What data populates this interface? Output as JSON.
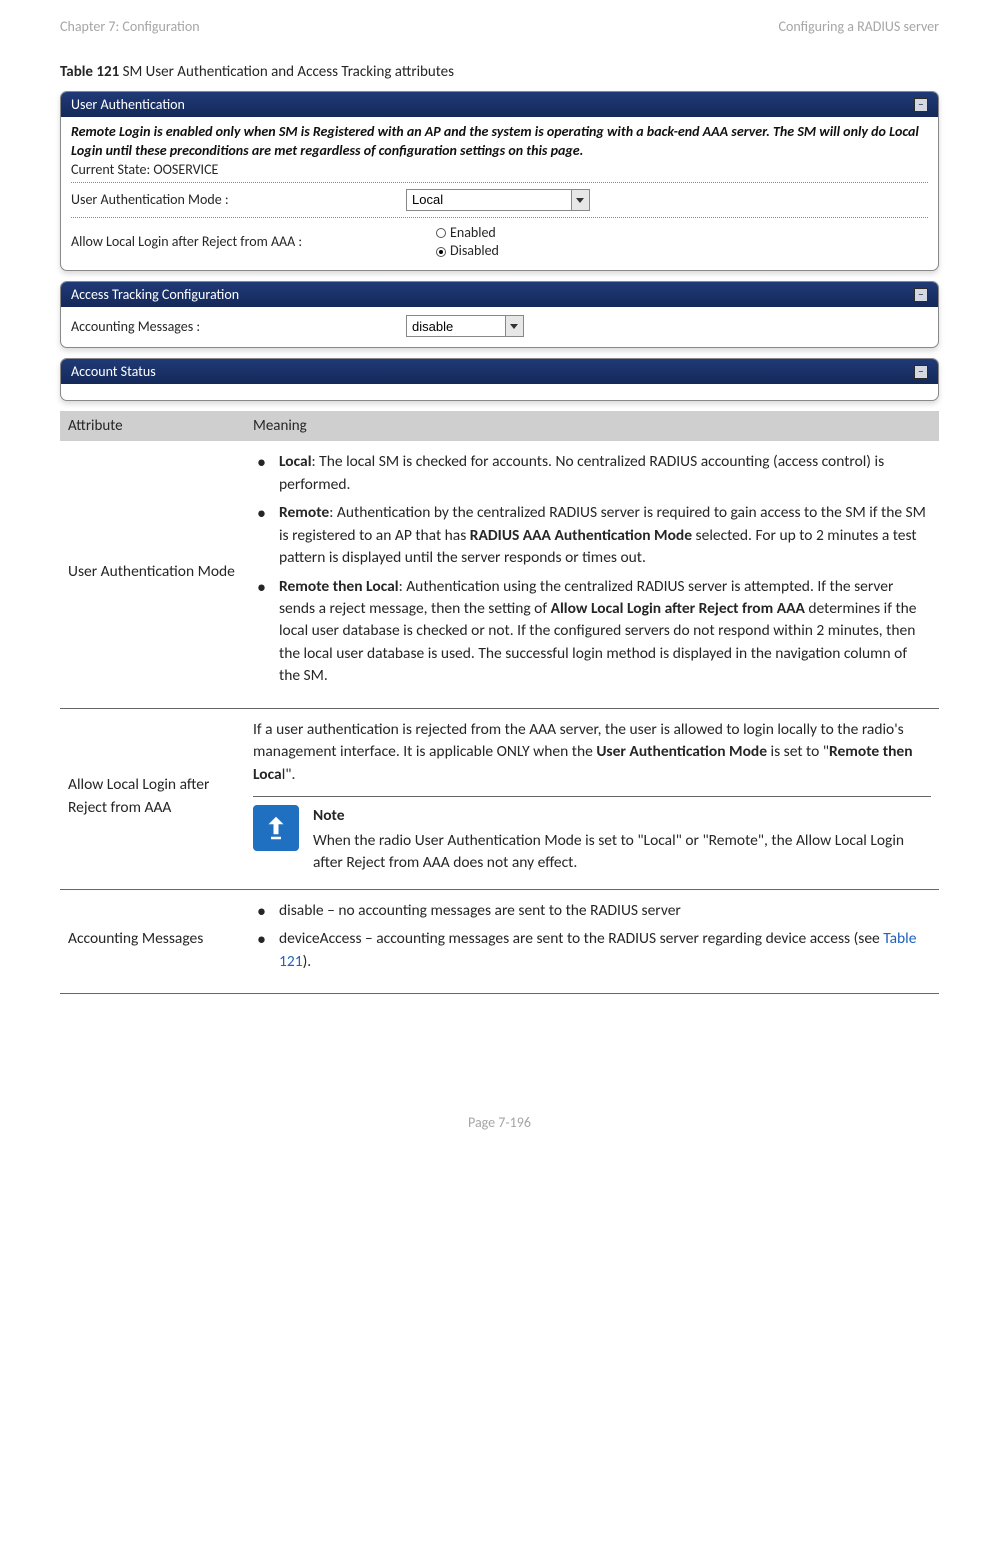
{
  "header": {
    "left": "Chapter 7:  Configuration",
    "right": "Configuring a RADIUS server"
  },
  "caption": {
    "bold": "Table 121",
    "rest": " SM User Authentication and Access Tracking attributes"
  },
  "panel1": {
    "title": "User Authentication",
    "intro": "Remote Login is enabled only when SM is Registered with an AP and the system is operating with a back-end AAA server. The SM will only do Local Login until these preconditions are met regardless of configuration settings on this page.",
    "stateLabel": "Current State: OOSERVICE",
    "modeLabel": "User Authentication Mode :",
    "modeValue": "Local",
    "allowLabel": "Allow Local Login after Reject from AAA :",
    "enabled": "Enabled",
    "disabled": "Disabled"
  },
  "panel2": {
    "title": "Access Tracking Configuration",
    "acctLabel": "Accounting Messages :",
    "acctValue": "disable"
  },
  "panel3": {
    "title": "Account Status"
  },
  "tableHead": {
    "attr": "Attribute",
    "meaning": "Meaning"
  },
  "row1": {
    "attr": "User Authentication Mode",
    "b1_bold": "Local",
    "b1_rest": ": The local SM is checked for accounts. No centralized RADIUS accounting (access control) is performed.",
    "b2_bold": "Remote",
    "b2_p1": ": Authentication by the centralized RADIUS server is required to gain access to the SM if the SM is registered to an AP that has ",
    "b2_bold2": "RADIUS AAA Authentication Mode",
    "b2_p2": " selected. For up to 2 minutes a test pattern is displayed until the server responds or times out.",
    "b3_bold": "Remote then Local",
    "b3_p1": ": Authentication using the centralized RADIUS server is attempted. If the server sends a reject message, then the setting of ",
    "b3_bold2": "Allow Local Login after Reject from AAA",
    "b3_p2": " determines if the local user database is checked or not. If the configured servers do not respond within 2 minutes, then the local user database is used. The successful login method is displayed in the navigation column of the SM."
  },
  "row2": {
    "attr": "Allow Local Login after Reject from AAA",
    "p_pre": "If a user authentication is rejected from the AAA server, the user is allowed to login locally to the radio's management interface. It is applicable ONLY when the ",
    "p_bold1": "User Authentication Mode",
    "p_mid": " is set to \"",
    "p_bold2": "Remote then Loca",
    "p_post": "l\".",
    "noteTitle": "Note",
    "noteBody": "When the radio User Authentication Mode is set to \"Local\" or \"Remote\", the Allow Local Login after Reject from AAA does not any effect."
  },
  "row3": {
    "attr": "Accounting Messages",
    "b1": "disable – no accounting messages are sent to the RADIUS server",
    "b2_pre": "deviceAccess – accounting messages are sent to the RADIUS server regarding device access (see ",
    "b2_link": "Table 121",
    "b2_post": ")."
  },
  "footer": "Page 7-196"
}
